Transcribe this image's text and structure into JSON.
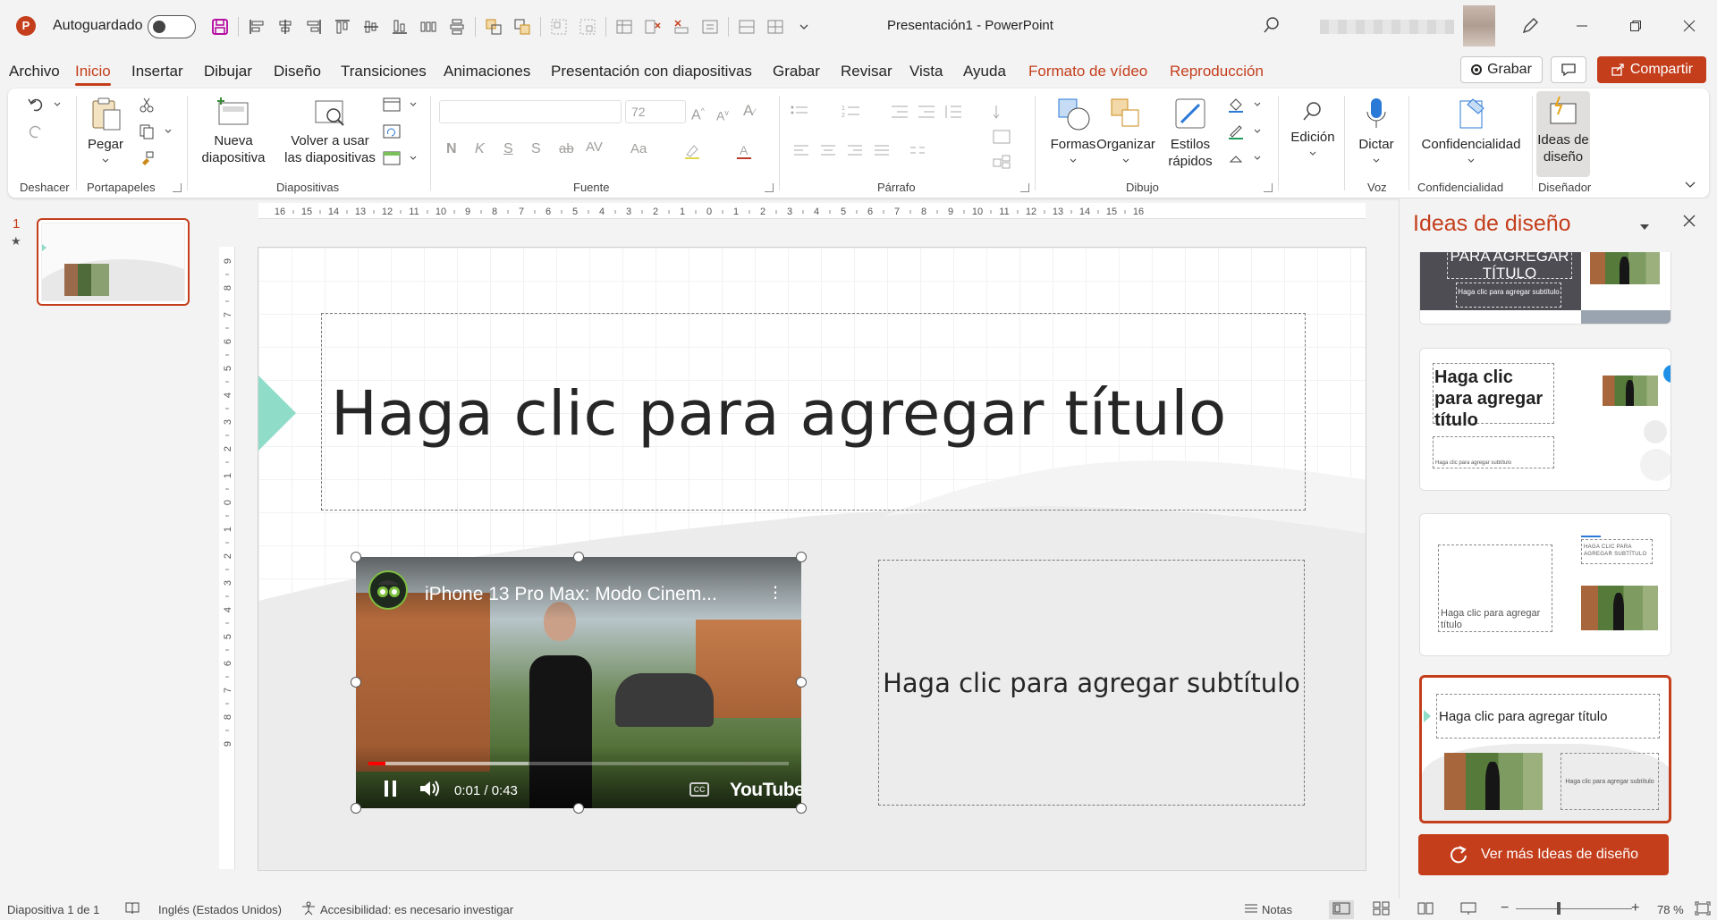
{
  "titlebar": {
    "autosave_label": "Autoguardado",
    "autosave_on": false,
    "doc_title": "Presentación1  -  PowerPoint",
    "app_icon_letter": "P"
  },
  "menu": {
    "tabs": [
      {
        "label": "Archivo"
      },
      {
        "label": "Inicio"
      },
      {
        "label": "Insertar"
      },
      {
        "label": "Dibujar"
      },
      {
        "label": "Diseño"
      },
      {
        "label": "Transiciones"
      },
      {
        "label": "Animaciones"
      },
      {
        "label": "Presentación con diapositivas"
      },
      {
        "label": "Grabar"
      },
      {
        "label": "Revisar"
      },
      {
        "label": "Vista"
      },
      {
        "label": "Ayuda"
      },
      {
        "label": "Formato de vídeo"
      },
      {
        "label": "Reproducción"
      }
    ],
    "record_label": "Grabar",
    "share_label": "Compartir"
  },
  "ribbon": {
    "groups": {
      "undo": "Deshacer",
      "clipboard": "Portapapeles",
      "slides": "Diapositivas",
      "font": "Fuente",
      "paragraph": "Párrafo",
      "drawing": "Dibujo",
      "voice": "Voz",
      "sensitivity": "Confidencialidad",
      "designer": "Diseñador"
    },
    "paste": "Pegar",
    "new_slide_1": "Nueva",
    "new_slide_2": "diapositiva",
    "reuse_1": "Volver a usar",
    "reuse_2": "las diapositivas",
    "font_size": "72",
    "shapes": "Formas",
    "arrange": "Organizar",
    "quick_styles_1": "Estilos",
    "quick_styles_2": "rápidos",
    "editing": "Edición",
    "dictate": "Dictar",
    "sensitivity": "Confidencialidad",
    "design_ideas_1": "Ideas de",
    "design_ideas_2": "diseño"
  },
  "ruler": {
    "h_labels": [
      "16",
      "15",
      "14",
      "13",
      "12",
      "11",
      "10",
      "9",
      "8",
      "7",
      "6",
      "5",
      "4",
      "3",
      "2",
      "1",
      "0",
      "1",
      "2",
      "3",
      "4",
      "5",
      "6",
      "7",
      "8",
      "9",
      "10",
      "11",
      "12",
      "13",
      "14",
      "15",
      "16"
    ],
    "v_labels": [
      "9",
      "8",
      "7",
      "6",
      "5",
      "4",
      "3",
      "2",
      "1",
      "0",
      "1",
      "2",
      "3",
      "4",
      "5",
      "6",
      "7",
      "8",
      "9"
    ]
  },
  "thumbnails": {
    "number": "1",
    "star": "★"
  },
  "slide": {
    "title_placeholder": "Haga clic para agregar título",
    "subtitle_placeholder": "Haga clic para agregar subtítulo"
  },
  "video": {
    "title": "iPhone 13 Pro Max: Modo Cinem...",
    "time": "0:01 / 0:43",
    "progress": 0.04,
    "buffered": 0.38,
    "brand": "YouTube",
    "cc": "CC"
  },
  "design_pane": {
    "title": "Ideas de diseño",
    "idea1_title": "PARA AGREGAR TÍTULO",
    "idea1_subtitle": "Haga clic para agregar subtítulo",
    "idea2_title": "Haga clic para agregar título",
    "idea2_subtitle": "Haga clic para agregar subtítulo",
    "idea3_title": "Haga clic para agregar título",
    "idea3_subtitle": "HAGA CLIC PARA AGREGAR SUBTÍTULO",
    "idea4_title": "Haga clic para agregar título",
    "idea4_subtitle": "Haga clic para agregar subtítulo",
    "more_button": "Ver más Ideas de diseño"
  },
  "statusbar": {
    "slide_info": "Diapositiva 1 de 1",
    "language": "Inglés (Estados Unidos)",
    "accessibility": "Accesibilidad: es necesario investigar",
    "notes": "Notas",
    "zoom": "78 %",
    "zoom_level": 0.35
  },
  "colors": {
    "accent": "#c43e1c",
    "slide_accent": "#8fdcc8"
  }
}
